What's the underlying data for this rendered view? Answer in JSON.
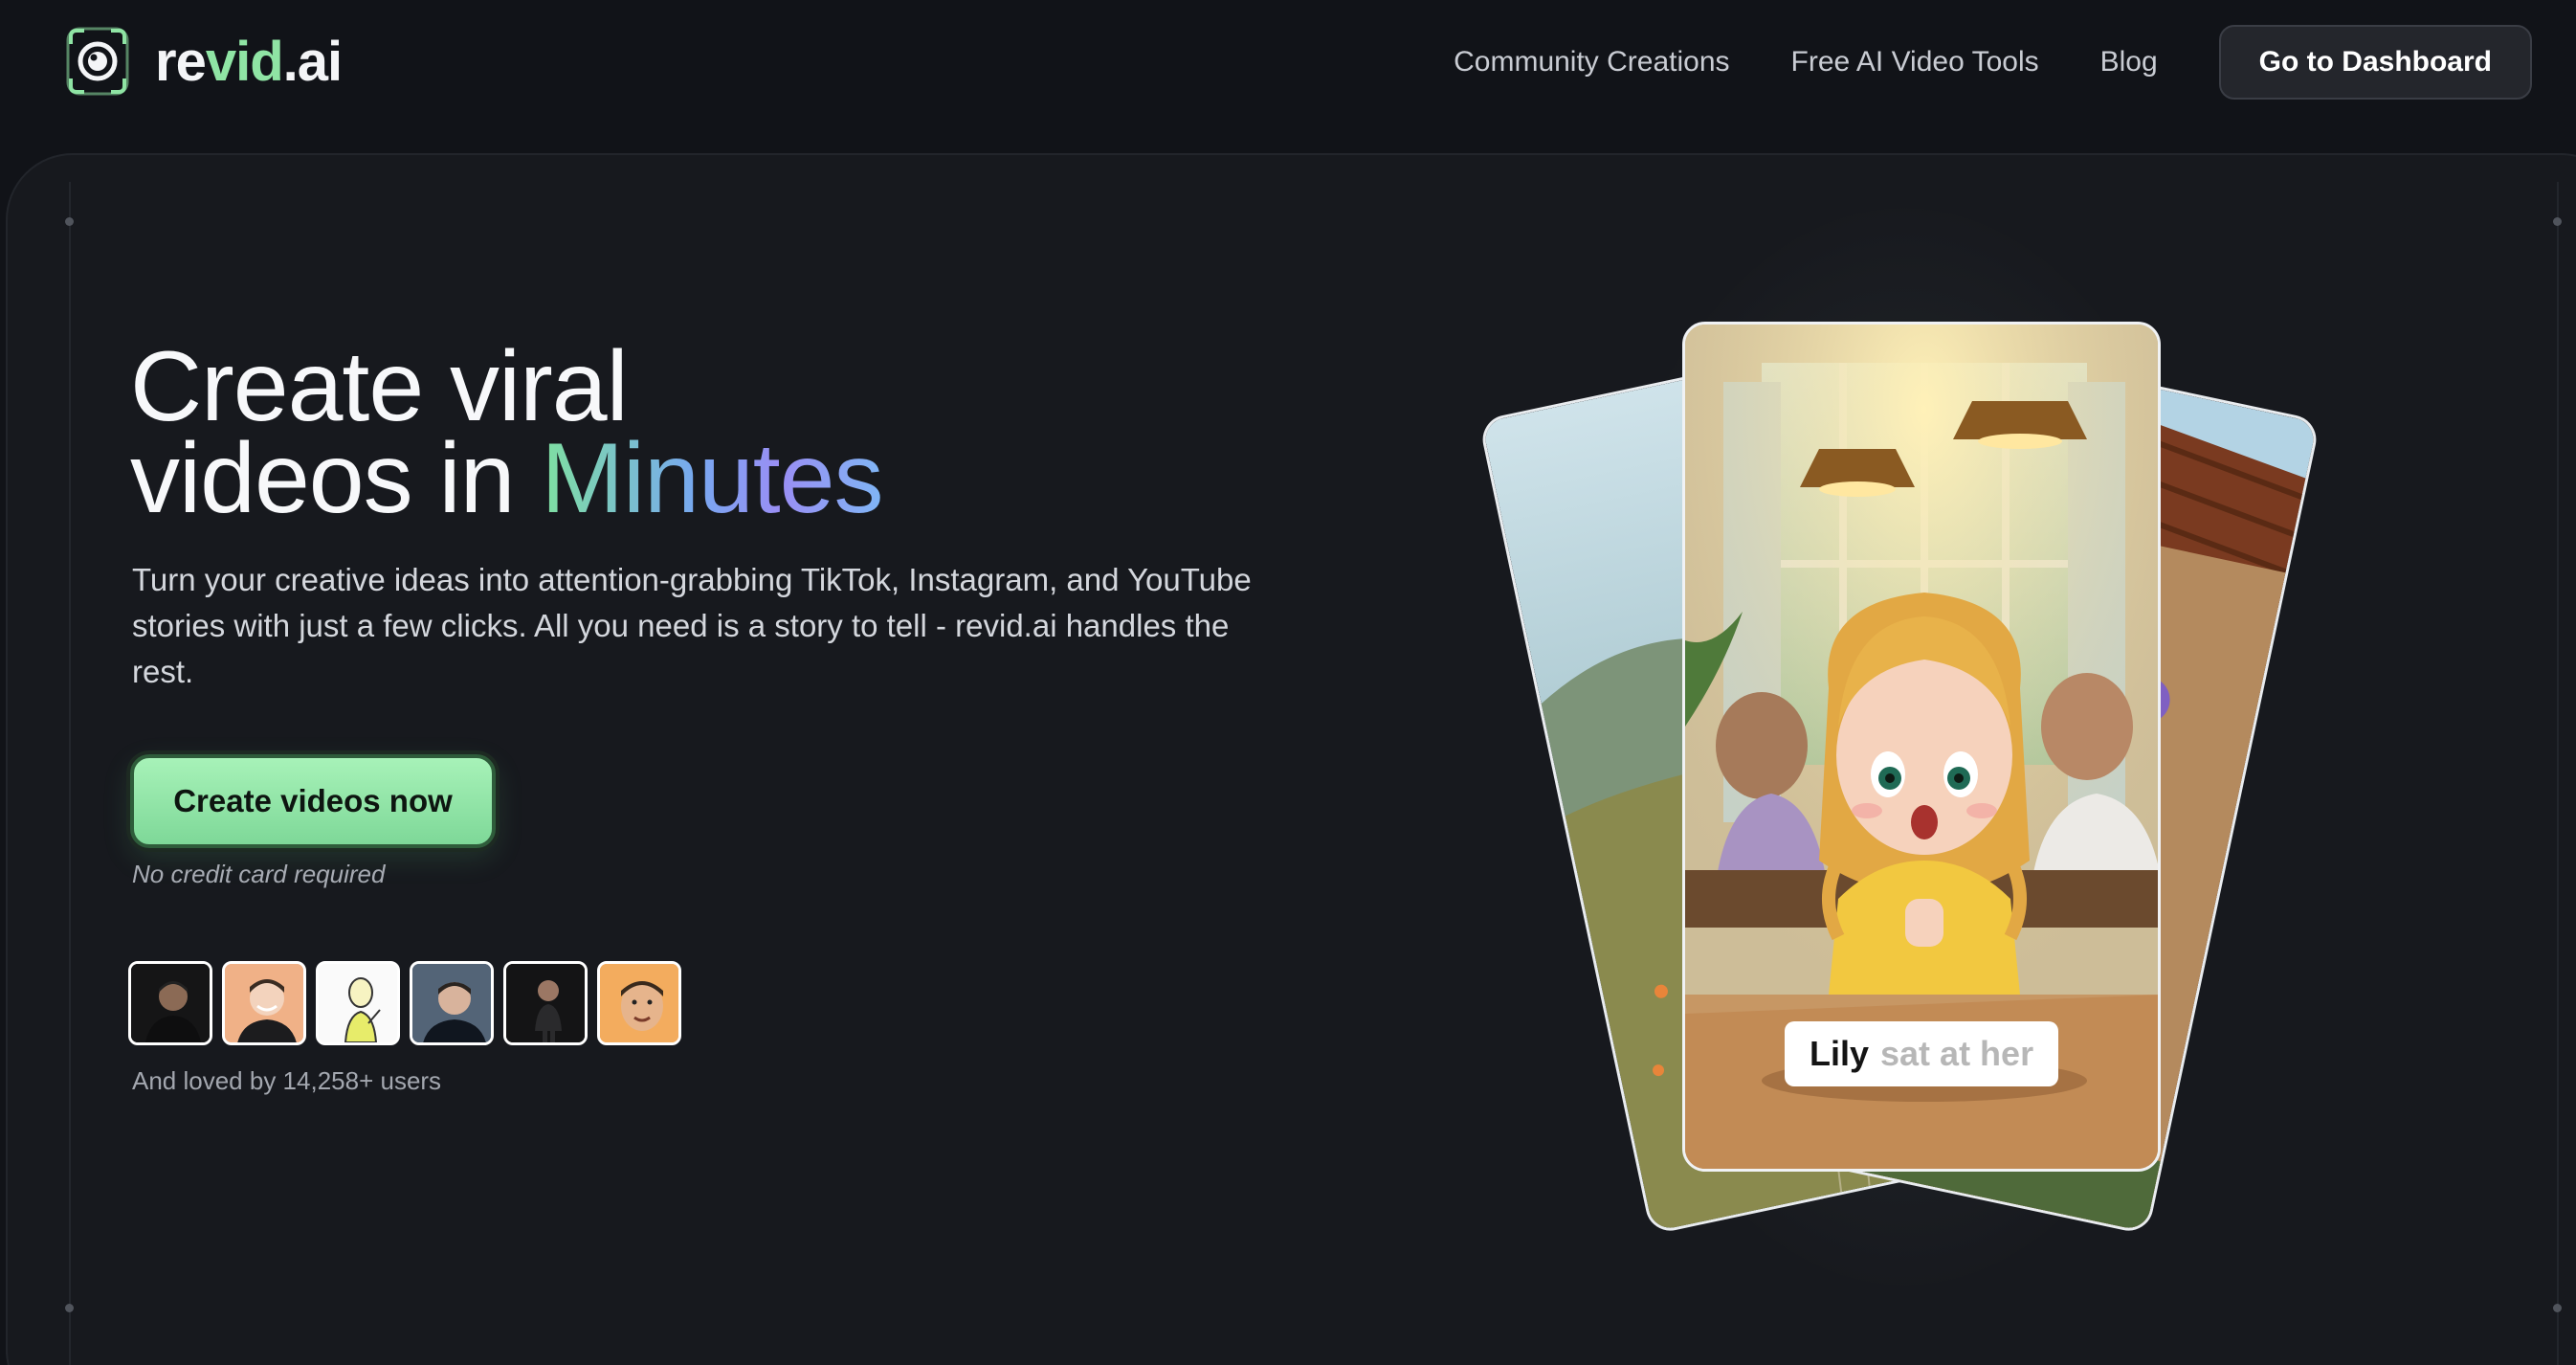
{
  "brand": {
    "name_part1": "re",
    "name_part2": "vid",
    "name_part3": ".ai"
  },
  "nav": {
    "links": [
      "Community Creations",
      "Free AI Video Tools",
      "Blog"
    ],
    "dashboard_label": "Go to Dashboard"
  },
  "hero": {
    "headline_line1": "Create viral",
    "headline_line2_prefix": "videos in ",
    "headline_line2_highlight": "Minutes",
    "subtext": "Turn your creative ideas into attention-grabbing TikTok, Instagram, and YouTube stories with just a few clicks. All you need is a story to tell - revid.ai handles the rest.",
    "cta_label": "Create videos now",
    "cta_note": "No credit card required",
    "social_proof": "And loved by 14,258+ users",
    "avatar_count": 6
  },
  "preview": {
    "caption_word_active": "Lily",
    "caption_words_upcoming": "sat at her"
  },
  "colors": {
    "background": "#111318",
    "accent_green": "#8fe4a4",
    "accent_blue": "#77a8f0"
  }
}
